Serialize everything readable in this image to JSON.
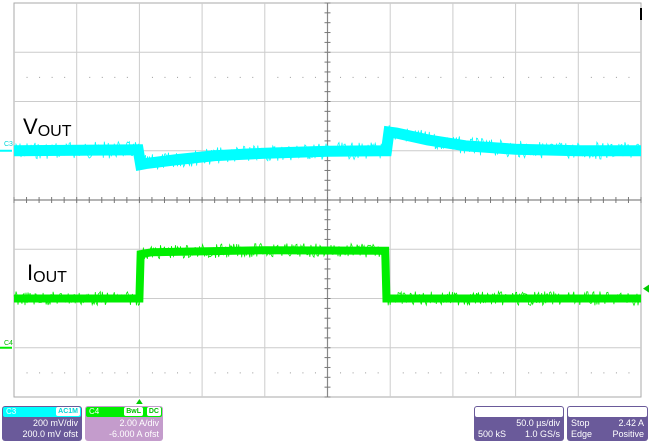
{
  "chart_data": {
    "type": "line",
    "title": "",
    "x_unit": "µs",
    "xlim": [
      0,
      500
    ],
    "ylim_divisions": [
      -4,
      4
    ],
    "x_divisions": 10,
    "y_divisions": 8,
    "grid": true,
    "series": [
      {
        "name": "VOUT",
        "label_main": "V",
        "label_sub": "OUT",
        "channel": "C3",
        "color": "#00ffff",
        "points": [
          [
            0,
            1.0
          ],
          [
            99,
            1.02
          ],
          [
            101,
            0.72
          ],
          [
            105,
            0.74
          ],
          [
            130,
            0.82
          ],
          [
            160,
            0.9
          ],
          [
            200,
            0.95
          ],
          [
            250,
            0.99
          ],
          [
            297,
            1.0
          ],
          [
            299,
            1.38
          ],
          [
            305,
            1.36
          ],
          [
            330,
            1.22
          ],
          [
            360,
            1.1
          ],
          [
            400,
            1.03
          ],
          [
            450,
            1.0
          ],
          [
            500,
            1.0
          ]
        ]
      },
      {
        "name": "IOUT",
        "label_main": "I",
        "label_sub": "OUT",
        "channel": "C4",
        "color": "#00ee00",
        "points": [
          [
            0,
            -2.0
          ],
          [
            100,
            -2.0
          ],
          [
            101,
            -1.1
          ],
          [
            110,
            -1.06
          ],
          [
            200,
            -1.02
          ],
          [
            296,
            -1.03
          ],
          [
            297,
            -2.0
          ],
          [
            500,
            -2.0
          ]
        ]
      }
    ]
  },
  "channels": {
    "c3": {
      "name": "C3",
      "coupling": "AC1M",
      "scale": "200 mV/div",
      "offset": "200.0 mV ofst",
      "color": "#00ffff"
    },
    "c4": {
      "name": "C4",
      "bw": "BwL",
      "coupling": "DC",
      "scale": "2.00 A/div",
      "offset": "-6.000 A ofst",
      "color": "#00ee00"
    }
  },
  "timebase": {
    "scale": "50.0 µs/div",
    "samples": "500 kS",
    "rate": "1.0 GS/s"
  },
  "trigger": {
    "mode": "Stop",
    "level": "2.42 A",
    "type": "Edge",
    "slope": "Positive"
  }
}
